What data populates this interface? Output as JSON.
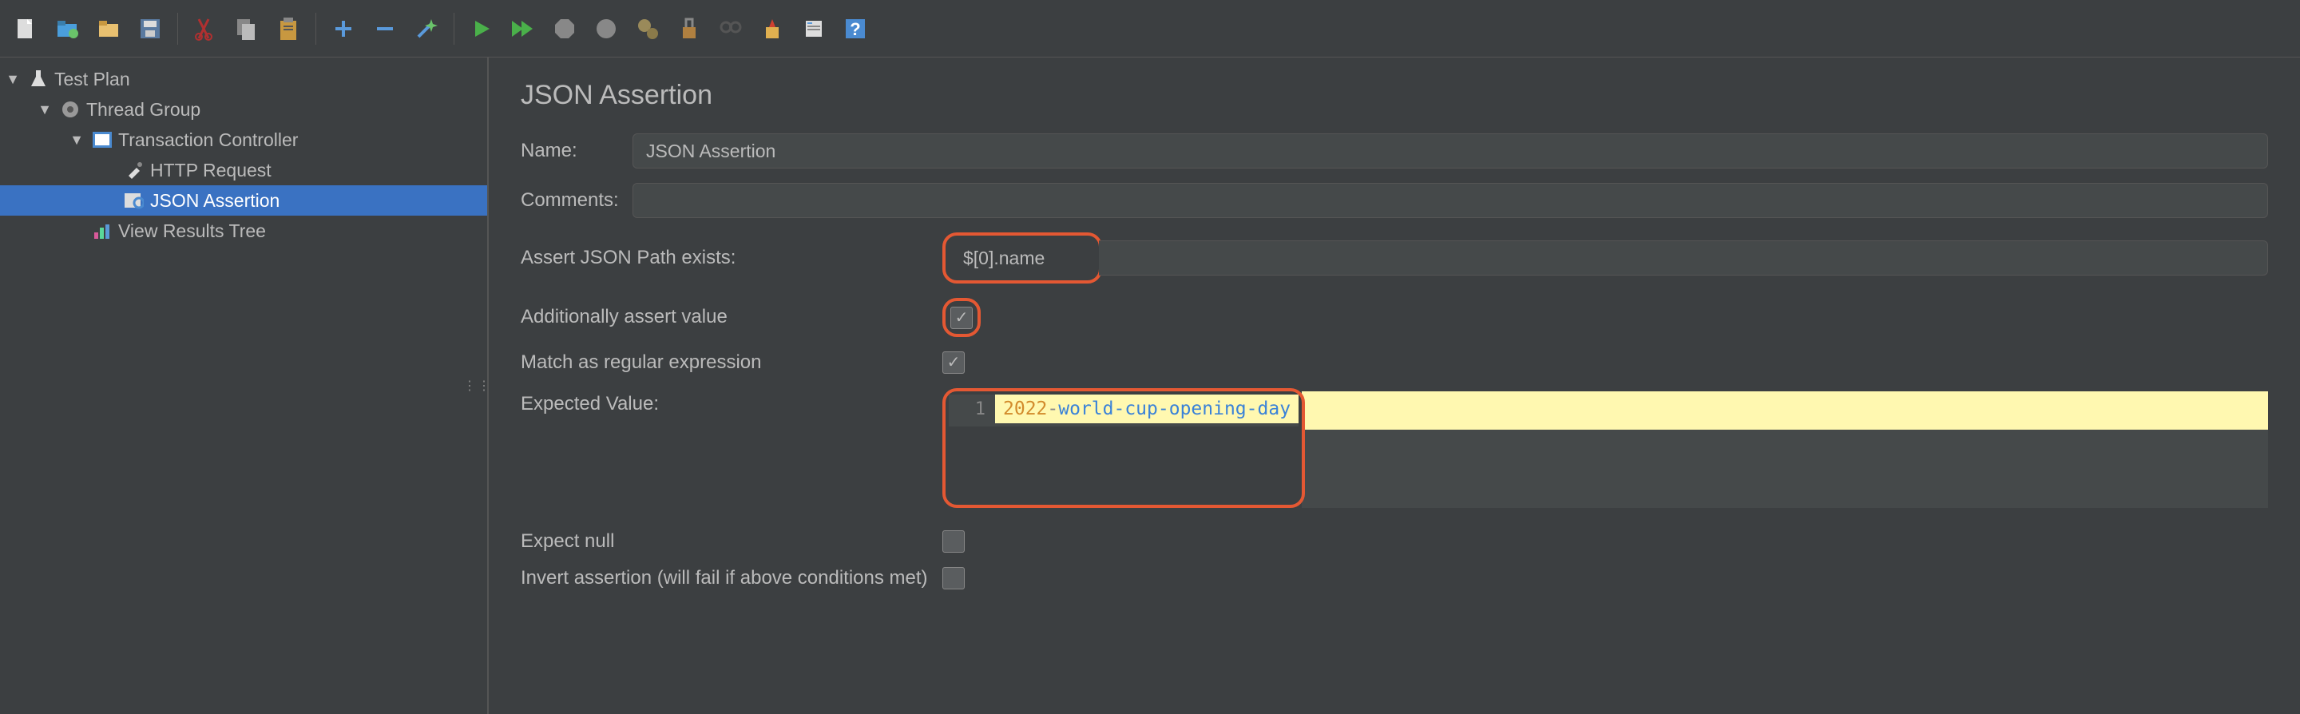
{
  "toolbar_icons": [
    "new-file",
    "open-folder",
    "open-project",
    "save",
    "cut",
    "copy",
    "paste",
    "plus",
    "minus",
    "wand",
    "run",
    "run-loop",
    "stop",
    "stop-remote",
    "gears",
    "broom",
    "binoculars",
    "clear",
    "toggle-log",
    "help"
  ],
  "tree": {
    "root": {
      "label": "Test Plan"
    },
    "thread_group": {
      "label": "Thread Group"
    },
    "transaction_controller": {
      "label": "Transaction Controller"
    },
    "http_request": {
      "label": "HTTP Request"
    },
    "json_assertion": {
      "label": "JSON Assertion"
    },
    "view_results_tree": {
      "label": "View Results Tree"
    }
  },
  "editor": {
    "title": "JSON Assertion",
    "labels": {
      "name": "Name:",
      "comments": "Comments:",
      "assert_json_path": "Assert JSON Path exists:",
      "additionally_assert": "Additionally assert value",
      "match_regex": "Match as regular expression",
      "expected_value": "Expected Value:",
      "expect_null": "Expect null",
      "invert_assertion": "Invert assertion (will fail if above conditions met)"
    },
    "values": {
      "name": "JSON Assertion",
      "comments": "",
      "assert_json_path": "$[0].name",
      "additionally_assert_checked": true,
      "match_regex_checked": true,
      "expected_value_line_num": "1",
      "expected_value_num": "2022",
      "expected_value_rest": "world-cup-opening-day",
      "expect_null_checked": false,
      "invert_assertion_checked": false
    }
  }
}
